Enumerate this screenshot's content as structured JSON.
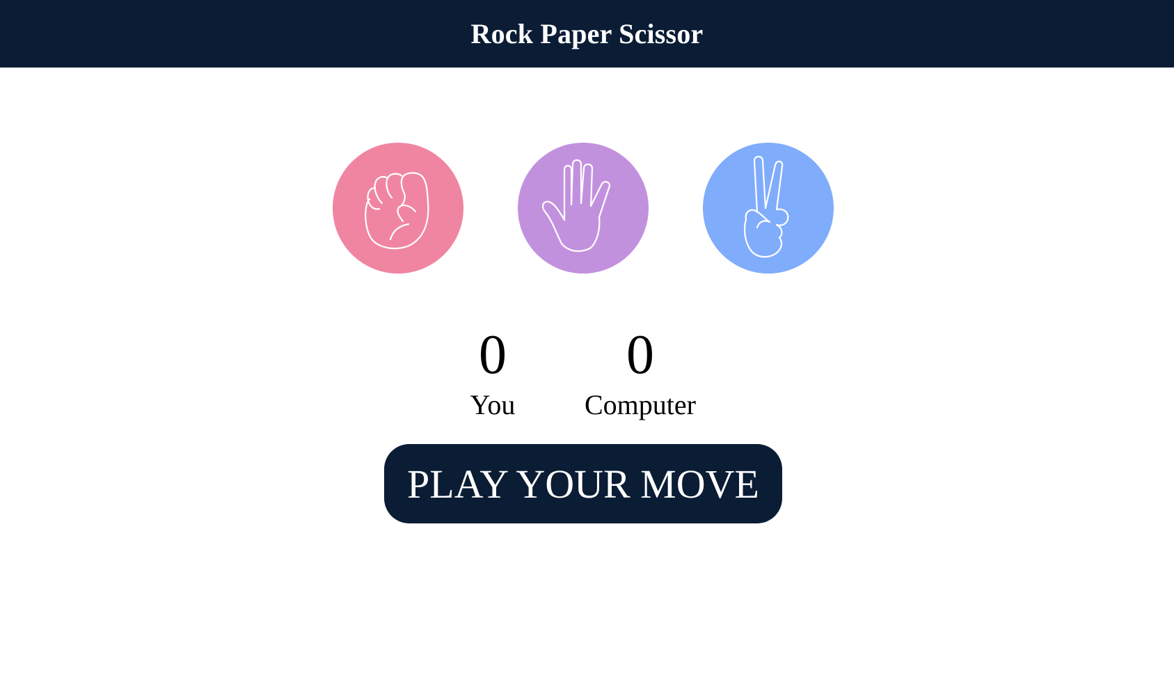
{
  "header": {
    "title": "Rock Paper Scissor"
  },
  "choices": [
    {
      "name": "rock",
      "icon": "fist-icon",
      "color": "#f085a2"
    },
    {
      "name": "paper",
      "icon": "open-hand-icon",
      "color": "#c291de"
    },
    {
      "name": "scissor",
      "icon": "peace-hand-icon",
      "color": "#80acfc"
    }
  ],
  "scores": {
    "you": {
      "value": "0",
      "label": "You"
    },
    "computer": {
      "value": "0",
      "label": "Computer"
    }
  },
  "play_button": {
    "label": "PLAY YOUR MOVE"
  },
  "colors": {
    "header_bg": "#0b1d35",
    "button_bg": "#0b1d35",
    "rock": "#f085a2",
    "paper": "#c291de",
    "scissor": "#80acfc"
  }
}
